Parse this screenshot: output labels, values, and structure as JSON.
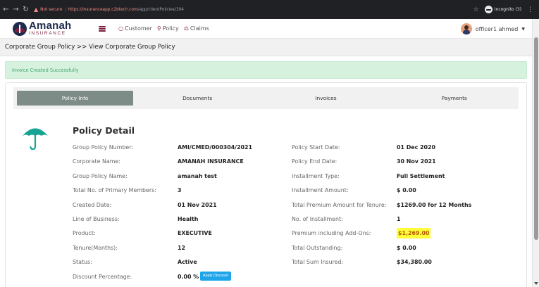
{
  "browser": {
    "back_icon": "arrow-left-icon",
    "forward_icon": "arrow-right-icon",
    "reload_icon": "reload-icon",
    "security_label": "Not secure",
    "url_host": "https://insuranceapp.c2btech.com",
    "url_path": "/app/clientPolicies/304",
    "incognito_label": "Incognito (3)"
  },
  "header": {
    "logo_name": "Amanah",
    "logo_sub": "INSURANCE",
    "nav": [
      {
        "icon": "customer-icon",
        "label": "Customer"
      },
      {
        "icon": "policy-icon",
        "label": "Policy"
      },
      {
        "icon": "claims-icon",
        "label": "Claims"
      }
    ],
    "user_name": "officer1 ahmed"
  },
  "breadcrumb": "Corporate Group Policy >> View Corporate Group Policy",
  "alert": "Invoice Created Successfully",
  "tabs": [
    "Policy Info",
    "Documents",
    "Invoices",
    "Payments"
  ],
  "active_tab": "Policy Info",
  "policy_detail": {
    "title": "Policy Detail",
    "left": [
      {
        "label": "Group Policy Number:",
        "value": "AMI/CMED/000304/2021"
      },
      {
        "label": "Corporate Name:",
        "value": "AMANAH INSURANCE"
      },
      {
        "label": "Group Policy Name:",
        "value": "amanah test"
      },
      {
        "label": "Total No. of Primary Members:",
        "value": "3"
      },
      {
        "label": "Created Date:",
        "value": "01 Nov 2021"
      },
      {
        "label": "Line of Business:",
        "value": "Health"
      },
      {
        "label": "Product:",
        "value": "EXECUTIVE"
      },
      {
        "label": "Tenure(Months):",
        "value": "12"
      },
      {
        "label": "Status:",
        "value": "Active"
      },
      {
        "label": "Discount Percentage:",
        "value": "0.00 %"
      }
    ],
    "right": [
      {
        "label": "Policy Start Date:",
        "value": "01 Dec 2020"
      },
      {
        "label": "Policy End Date:",
        "value": "30 Nov 2021"
      },
      {
        "label": "Installment Type:",
        "value": "Full Settlement"
      },
      {
        "label": "Installment Amount:",
        "value": "$ 0.00"
      },
      {
        "label": "Total Premium Amount for Tenure:",
        "value": "$1269.00 for 12 Months"
      },
      {
        "label": "No. of Installment:",
        "value": "1"
      },
      {
        "label": "Premium including Add-Ons:",
        "value": "$1,269.00"
      },
      {
        "label": "Total Outstanding:",
        "value": "$ 0.00"
      },
      {
        "label": "Total Sum Insured:",
        "value": "$34,380.00"
      }
    ],
    "apply_discount_label": "Apply Discount"
  },
  "colors": {
    "brand_navy": "#1f2a4d",
    "brand_maroon": "#7a1f3d",
    "umbrella": "#16a594",
    "alert_bg": "#d6f2df",
    "active_tab": "#7d8c87",
    "apply_button": "#1ea5e9",
    "highlight": "#ffff3a"
  }
}
